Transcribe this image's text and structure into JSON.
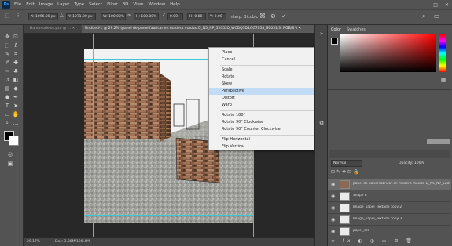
{
  "menubar": {
    "logo": "Ps",
    "menus": [
      "File",
      "Edit",
      "Image",
      "Layer",
      "Type",
      "Select",
      "Filter",
      "3D",
      "View",
      "Window",
      "Help"
    ],
    "controls": [
      "–",
      "□",
      "✕"
    ]
  },
  "options": {
    "x": "X: 1096.00 px",
    "y": "Y: 1071.00 px",
    "w": "W: 100.00%",
    "h": "H: 100.00%",
    "angle": "0.00",
    "hskew": "H: 0.00",
    "vskew": "V: 0.00",
    "interp": "Interp: Bicubic"
  },
  "tabs": [
    {
      "label": "Handmodelos.psd @ ... ✕"
    },
    {
      "label": "Untitled-1 @ 29.2% (panel de panel fabricar en madera macizo D_N5_NP_520520_WCDQ3D1GG7058_S0031.3, RGB/8*) ✕"
    }
  ],
  "status": {
    "zoom": "29.17%",
    "doc": "Doc: 3.88M/126.4M"
  },
  "context_menu": {
    "items": [
      "Place",
      "Cancel",
      "Scale",
      "Rotate",
      "Skew",
      "Perspective",
      "Distort",
      "Warp",
      "Rotate 180°",
      "Rotate 90° Clockwise",
      "Rotate 90° Counter Clockwise",
      "Flip Horizontal",
      "Flip Vertical"
    ],
    "highlighted": "Perspective"
  },
  "panels": {
    "color_tab": "Color",
    "swatches_tab": "Swatches",
    "layers_mode": "Normal",
    "opacity": "Opacity: 100%",
    "layers": [
      {
        "name": "panel de panel fabricar en madera macizo D_N5_NP_520520..."
      },
      {
        "name": "Shape 8"
      },
      {
        "name": "Image_papel_Textado copy 2"
      },
      {
        "name": "Image_papel_Textado copy 3"
      },
      {
        "name": "papel_arq"
      }
    ]
  },
  "colors": {
    "accent": "#31a8ff",
    "highlight": "#c3dcf5",
    "guide": "#38c7d6"
  }
}
